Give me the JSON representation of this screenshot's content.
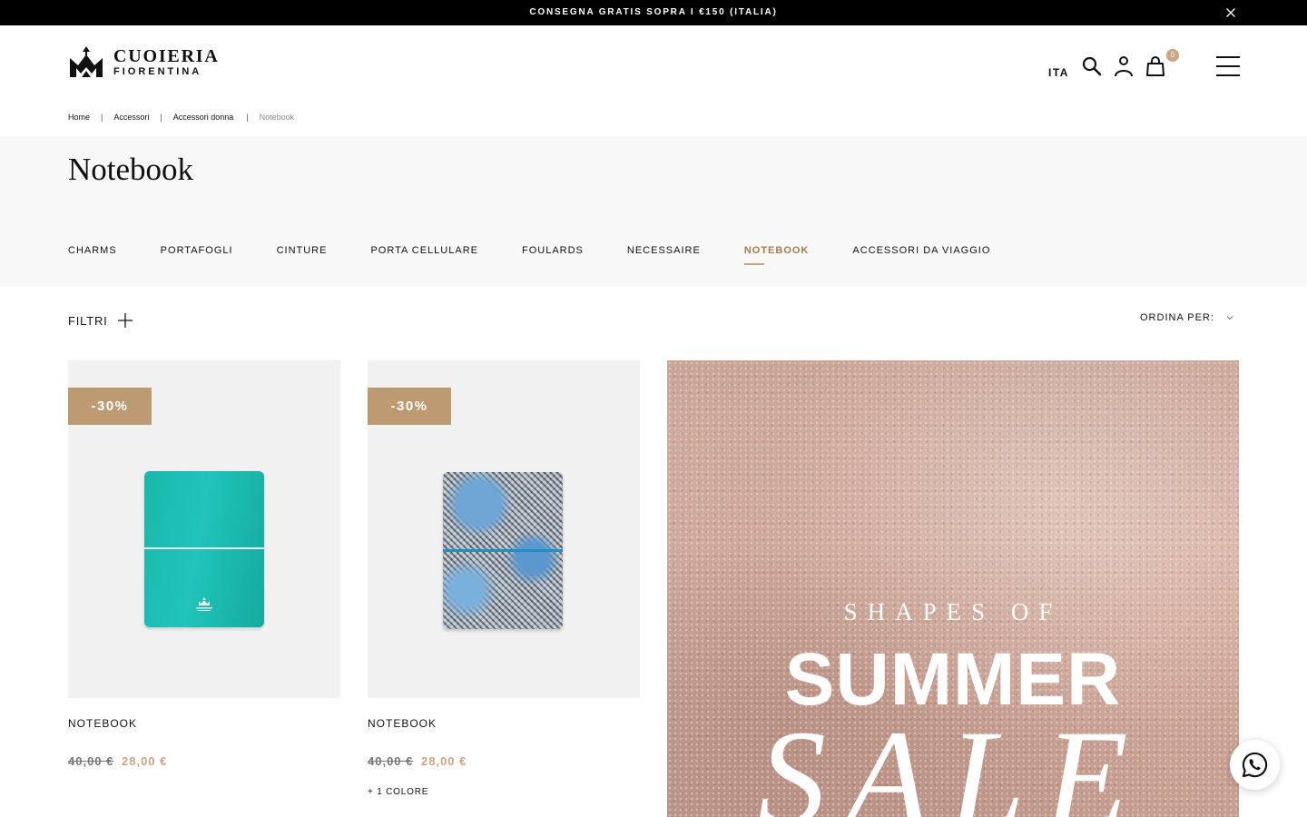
{
  "announcement": {
    "text": "CONSEGNA GRATIS SOPRA I €150 (ITALIA)",
    "close_icon": "close-icon"
  },
  "header": {
    "logo_line1": "CUOIERIA",
    "logo_line2": "FIORENTINA",
    "language": "ITA",
    "cart_count": "0",
    "icons": [
      "search-icon",
      "user-icon",
      "shopping-bag-icon",
      "hamburger-menu-icon"
    ]
  },
  "breadcrumb": {
    "items": [
      "Home",
      "Accessori",
      "Accessori donna"
    ],
    "current": "Notebook",
    "separator": "|"
  },
  "category": {
    "title": "Notebook",
    "subnav": [
      "CHARMS",
      "PORTAFOGLI",
      "CINTURE",
      "PORTA CELLULARE",
      "FOULARDS",
      "NECESSAIRE",
      "NOTEBOOK",
      "ACCESSORI DA VIAGGIO"
    ],
    "active": "NOTEBOOK"
  },
  "toolbar": {
    "filters_label": "FILTRI",
    "sort_label": "ORDINA PER:"
  },
  "products": [
    {
      "badge": "-30%",
      "name": "NOTEBOOK",
      "old_price": "40,00 €",
      "new_price": "28,00 €",
      "colors": ""
    },
    {
      "badge": "-30%",
      "name": "NOTEBOOK",
      "old_price": "40,00 €",
      "new_price": "28,00 €",
      "colors": "+ 1 COLORE"
    }
  ],
  "promo": {
    "pre": "SHAPES OF",
    "main": "SUMMER",
    "script": "SALE"
  },
  "colors": {
    "accent": "#c9a581",
    "badge": "#be9a73",
    "topbar": "#000000",
    "hero_bg": "#f8f8f8"
  }
}
